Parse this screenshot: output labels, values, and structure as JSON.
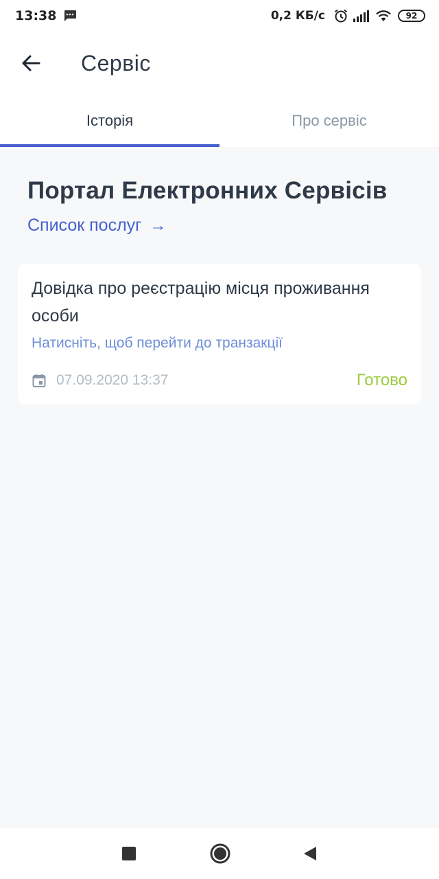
{
  "status_bar": {
    "time": "13:38",
    "net_speed": "0,2 КБ/с",
    "battery": "92",
    "icons": [
      "message-icon",
      "alarm-icon",
      "signal-icon",
      "wifi-icon",
      "battery-icon"
    ]
  },
  "app_bar": {
    "title": "Сервіс",
    "back_icon": "arrow-left-icon"
  },
  "tabs": [
    {
      "label": "Історія",
      "active": true
    },
    {
      "label": "Про сервіс",
      "active": false
    }
  ],
  "content": {
    "portal_title": "Портал Електронних Сервісів",
    "services_link": "Список послуг",
    "services_link_arrow": "→",
    "cards": [
      {
        "title": "Довідка про реєстрацію місця проживання особи",
        "hint": "Натисніть, щоб перейти до транзакції",
        "date": "07.09.2020 13:37",
        "status": "Готово"
      }
    ]
  },
  "colors": {
    "accent": "#4660cf",
    "link": "#4660cf",
    "hint": "#6d8ed8",
    "status_ready": "#9ccb3c",
    "background": "#f6f8fa",
    "text": "#2f3a48"
  },
  "nav_bar": {
    "icons": [
      "square-icon",
      "home-circle-icon",
      "back-triangle-icon"
    ]
  }
}
